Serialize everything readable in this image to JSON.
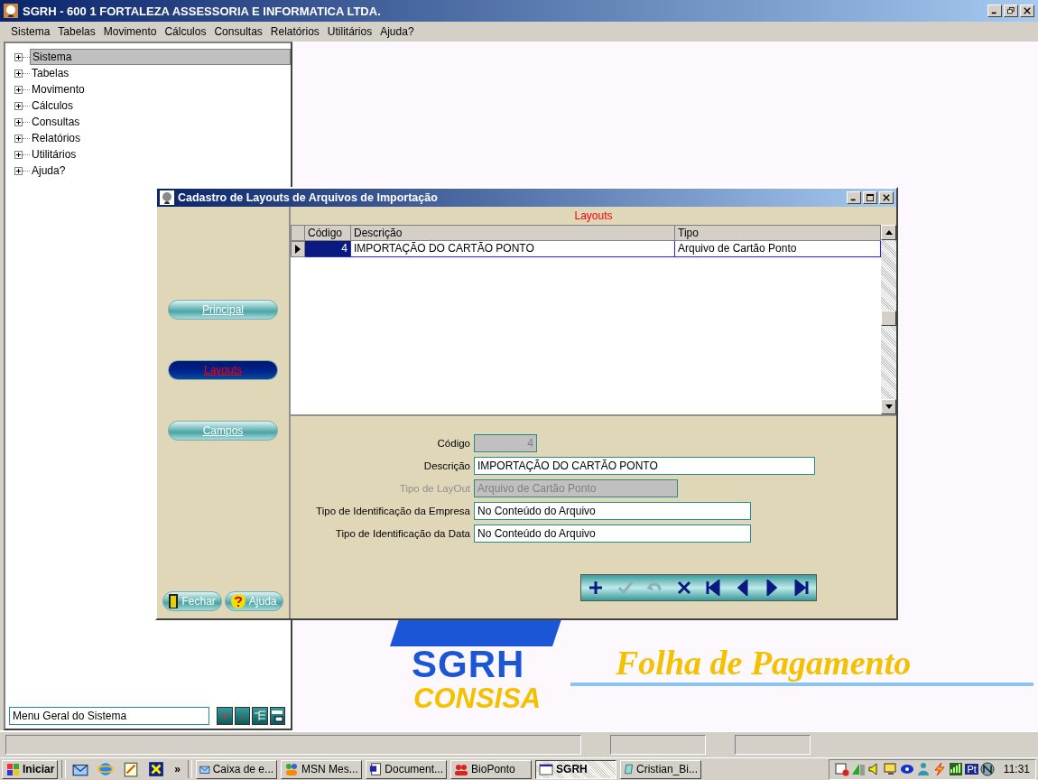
{
  "window": {
    "title": "SGRH - 600 1 FORTALEZA ASSESSORIA E INFORMATICA LTDA."
  },
  "menu": [
    {
      "label": "Sistema"
    },
    {
      "label": "Tabelas"
    },
    {
      "label": "Movimento"
    },
    {
      "label": "Cálculos"
    },
    {
      "label": "Consultas"
    },
    {
      "label": "Relatórios"
    },
    {
      "label": "Utilitários"
    },
    {
      "label": "Ajuda?"
    }
  ],
  "tree": {
    "items": [
      {
        "label": "Sistema",
        "expanded": false,
        "selected": true
      },
      {
        "label": "Tabelas",
        "expanded": false,
        "selected": false
      },
      {
        "label": "Movimento",
        "expanded": false,
        "selected": false
      },
      {
        "label": "Cálculos",
        "expanded": false,
        "selected": false
      },
      {
        "label": "Consultas",
        "expanded": false,
        "selected": false
      },
      {
        "label": "Relatórios",
        "expanded": false,
        "selected": false
      },
      {
        "label": "Utilitários",
        "expanded": false,
        "selected": false
      },
      {
        "label": "Ajuda?",
        "expanded": false,
        "selected": false
      }
    ],
    "filter_field": {
      "value": "Menu Geral do Sistema"
    },
    "buttons": [
      {
        "kind": "text",
        "label": "+"
      },
      {
        "kind": "text",
        "label": "-"
      },
      {
        "kind": "outline"
      },
      {
        "kind": "outline-selected"
      }
    ]
  },
  "dialog": {
    "title": "Cadastro de Layouts de Arquivos de Importação",
    "nav": [
      {
        "label": "Principal",
        "selected": false
      },
      {
        "label": "Layouts",
        "selected": true
      },
      {
        "label": "Campos",
        "selected": false
      }
    ],
    "grid": {
      "caption": "Layouts",
      "columns": [
        {
          "label": "Código"
        },
        {
          "label": "Descrição"
        },
        {
          "label": "Tipo"
        }
      ],
      "rows": [
        {
          "cells": [
            "4",
            "IMPORTAÇÃO DO CARTÃO PONTO",
            "Arquivo de Cartão Ponto"
          ],
          "selected": true
        }
      ]
    },
    "form": [
      {
        "label": "Código",
        "value": "4",
        "kind": "number",
        "disabled": true
      },
      {
        "label": "Descrição",
        "value": "IMPORTAÇÃO DO CARTÃO PONTO",
        "kind": "text",
        "disabled": false
      },
      {
        "label": "Tipo de LayOut",
        "value": "Arquivo de Cartão Ponto",
        "kind": "text",
        "disabled": true
      },
      {
        "label": "Tipo de Identificação da Empresa",
        "value": "No Conteúdo do Arquivo",
        "kind": "text",
        "disabled": false
      },
      {
        "label": "Tipo de Identificação da Data",
        "value": "No Conteúdo do Arquivo",
        "kind": "text",
        "disabled": false
      }
    ],
    "toolbar": [
      {
        "kind": "add",
        "disabled": false
      },
      {
        "kind": "confirm",
        "disabled": true
      },
      {
        "kind": "undo",
        "disabled": true
      },
      {
        "kind": "delete",
        "disabled": false
      },
      {
        "kind": "first",
        "disabled": false
      },
      {
        "kind": "prev",
        "disabled": false
      },
      {
        "kind": "next",
        "disabled": false
      },
      {
        "kind": "last",
        "disabled": false
      }
    ],
    "close_button": "Fechar",
    "help_button": "Ajuda"
  },
  "logo": {
    "product": "SGRH",
    "company": "CONSISA",
    "tagline": "Folha de Pagamento"
  },
  "taskbar": {
    "start": "Iniciar",
    "quick_launch": [
      {
        "kind": "mail"
      },
      {
        "kind": "browser"
      },
      {
        "kind": "notes"
      },
      {
        "kind": "app"
      }
    ],
    "overflow": "»",
    "tasks": [
      {
        "label": "Caixa de e...",
        "kind": "mail",
        "selected": false
      },
      {
        "label": "MSN Mes...",
        "kind": "people",
        "selected": false
      },
      {
        "label": "Document...",
        "kind": "word",
        "selected": false
      },
      {
        "label": "BioPonto",
        "kind": "bio",
        "selected": false
      },
      {
        "label": "SGRH",
        "kind": "window",
        "selected": true
      },
      {
        "label": "Cristian_Bi...",
        "kind": "notes",
        "selected": false
      }
    ],
    "tray": [
      {
        "kind": "calendar"
      },
      {
        "kind": "computer"
      },
      {
        "kind": "speaker"
      },
      {
        "kind": "monitor"
      },
      {
        "kind": "eye"
      },
      {
        "kind": "person"
      },
      {
        "kind": "lightning"
      },
      {
        "kind": "signal"
      }
    ],
    "language": "Pt",
    "clock": "11:31"
  }
}
